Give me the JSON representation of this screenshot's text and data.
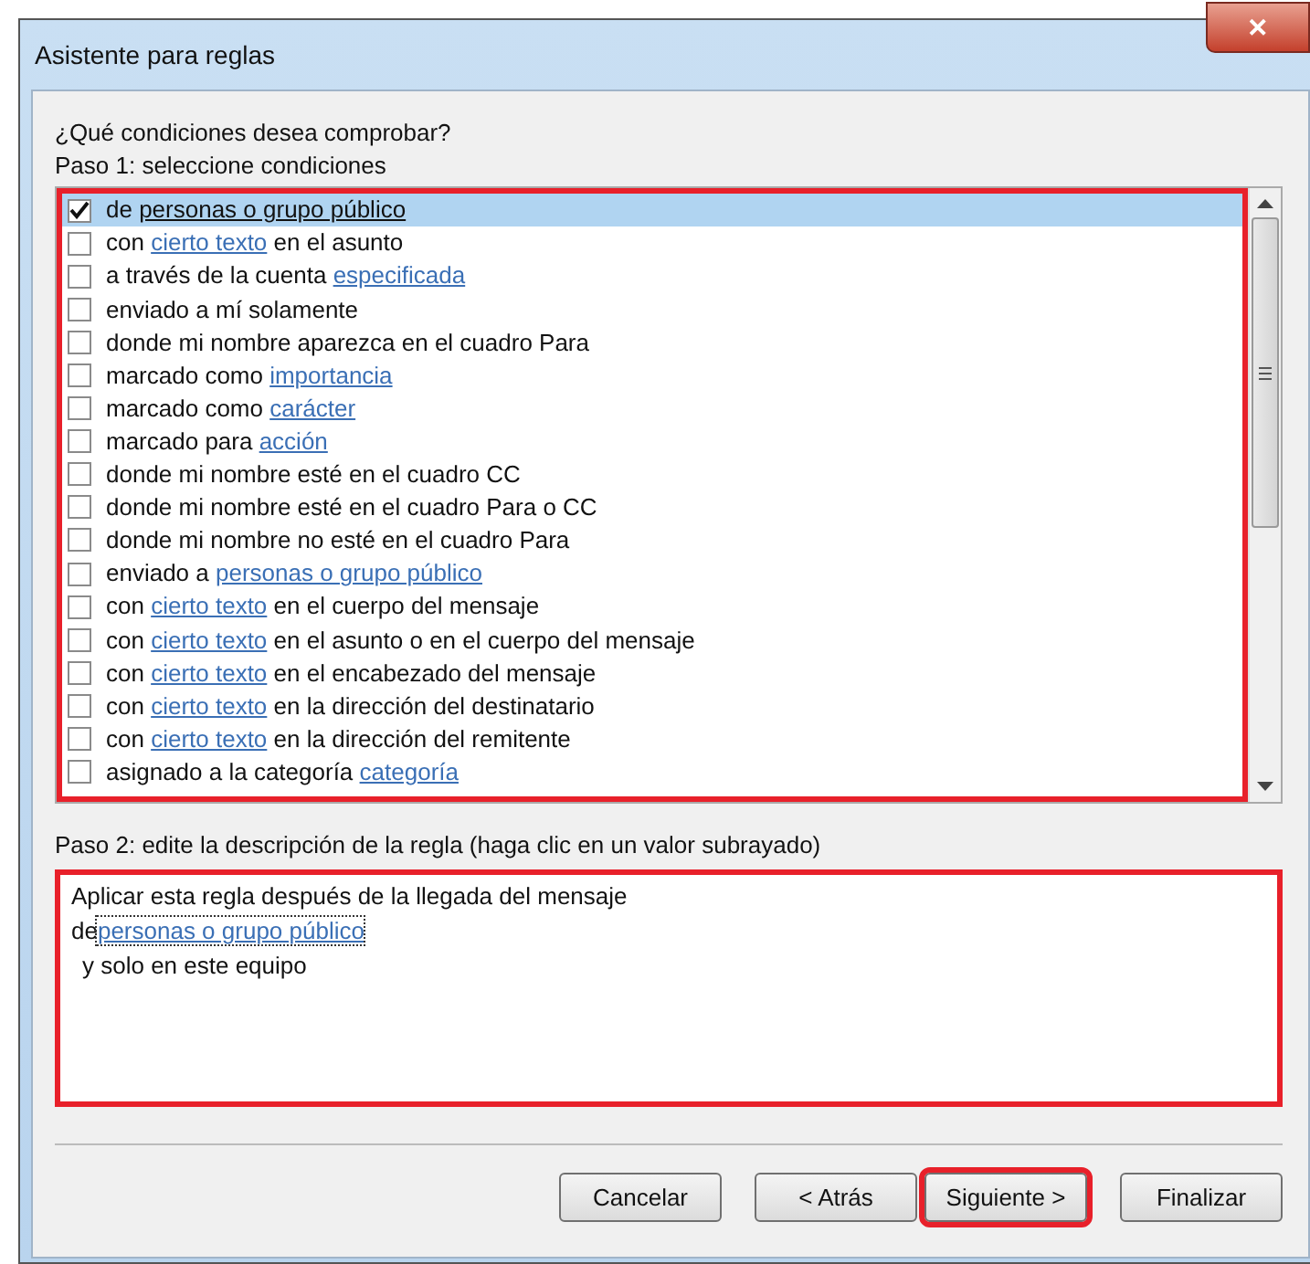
{
  "window": {
    "title": "Asistente para reglas",
    "close": "✕"
  },
  "question": "¿Qué condiciones desea comprobar?",
  "step1_label": "Paso 1: seleccione condiciones",
  "conditions": [
    {
      "checked": true,
      "selected": true,
      "parts": [
        {
          "kind": "plain",
          "text": "de "
        },
        {
          "kind": "link",
          "text": "personas o grupo público"
        }
      ]
    },
    {
      "checked": false,
      "selected": false,
      "parts": [
        {
          "kind": "plain",
          "text": "con "
        },
        {
          "kind": "link",
          "text": "cierto texto"
        },
        {
          "kind": "plain",
          "text": " en el asunto"
        }
      ]
    },
    {
      "checked": false,
      "selected": false,
      "parts": [
        {
          "kind": "plain",
          "text": "a través de la cuenta "
        },
        {
          "kind": "link",
          "text": "especificada"
        }
      ]
    },
    {
      "checked": false,
      "selected": false,
      "parts": [
        {
          "kind": "plain",
          "text": "enviado a mí solamente"
        }
      ]
    },
    {
      "checked": false,
      "selected": false,
      "parts": [
        {
          "kind": "plain",
          "text": "donde mi nombre aparezca en el cuadro Para"
        }
      ]
    },
    {
      "checked": false,
      "selected": false,
      "parts": [
        {
          "kind": "plain",
          "text": "marcado como "
        },
        {
          "kind": "link",
          "text": "importancia"
        }
      ]
    },
    {
      "checked": false,
      "selected": false,
      "parts": [
        {
          "kind": "plain",
          "text": "marcado como "
        },
        {
          "kind": "link",
          "text": "carácter"
        }
      ]
    },
    {
      "checked": false,
      "selected": false,
      "parts": [
        {
          "kind": "plain",
          "text": "marcado para "
        },
        {
          "kind": "link",
          "text": "acción"
        }
      ]
    },
    {
      "checked": false,
      "selected": false,
      "parts": [
        {
          "kind": "plain",
          "text": "donde mi nombre esté en el cuadro CC"
        }
      ]
    },
    {
      "checked": false,
      "selected": false,
      "parts": [
        {
          "kind": "plain",
          "text": "donde mi nombre esté en el cuadro Para o CC"
        }
      ]
    },
    {
      "checked": false,
      "selected": false,
      "parts": [
        {
          "kind": "plain",
          "text": "donde mi nombre no esté en el cuadro Para"
        }
      ]
    },
    {
      "checked": false,
      "selected": false,
      "parts": [
        {
          "kind": "plain",
          "text": "enviado a "
        },
        {
          "kind": "link",
          "text": "personas o grupo público"
        }
      ]
    },
    {
      "checked": false,
      "selected": false,
      "parts": [
        {
          "kind": "plain",
          "text": "con "
        },
        {
          "kind": "link",
          "text": "cierto texto"
        },
        {
          "kind": "plain",
          "text": " en el cuerpo del mensaje"
        }
      ]
    },
    {
      "checked": false,
      "selected": false,
      "parts": [
        {
          "kind": "plain",
          "text": "con "
        },
        {
          "kind": "link",
          "text": "cierto texto"
        },
        {
          "kind": "plain",
          "text": " en el asunto o en el cuerpo del mensaje"
        }
      ]
    },
    {
      "checked": false,
      "selected": false,
      "parts": [
        {
          "kind": "plain",
          "text": "con "
        },
        {
          "kind": "link",
          "text": "cierto texto"
        },
        {
          "kind": "plain",
          "text": " en el encabezado del mensaje"
        }
      ]
    },
    {
      "checked": false,
      "selected": false,
      "parts": [
        {
          "kind": "plain",
          "text": "con "
        },
        {
          "kind": "link",
          "text": "cierto texto"
        },
        {
          "kind": "plain",
          "text": " en la dirección del destinatario"
        }
      ]
    },
    {
      "checked": false,
      "selected": false,
      "parts": [
        {
          "kind": "plain",
          "text": "con "
        },
        {
          "kind": "link",
          "text": "cierto texto"
        },
        {
          "kind": "plain",
          "text": " en la dirección del remitente"
        }
      ]
    },
    {
      "checked": false,
      "selected": false,
      "parts": [
        {
          "kind": "plain",
          "text": "asignado a la categoría "
        },
        {
          "kind": "link",
          "text": "categoría"
        }
      ]
    }
  ],
  "step2_label": "Paso 2: edite la descripción de la regla (haga clic en un valor subrayado)",
  "description": [
    {
      "parts": [
        {
          "kind": "plain",
          "text": "Aplicar esta regla después de la llegada del mensaje"
        }
      ]
    },
    {
      "parts": [
        {
          "kind": "plain",
          "text": "de"
        },
        {
          "kind": "link",
          "text": "personas o grupo público"
        }
      ]
    },
    {
      "parts": [
        {
          "kind": "plain",
          "text": "y solo en este equipo"
        }
      ],
      "indented": true
    }
  ],
  "buttons": [
    {
      "label": "Cancelar",
      "highlighted": false
    },
    {
      "label": "< Atrás",
      "highlighted": false
    },
    {
      "label": "Siguiente >",
      "highlighted": true
    },
    {
      "label": "Finalizar",
      "highlighted": false
    }
  ]
}
